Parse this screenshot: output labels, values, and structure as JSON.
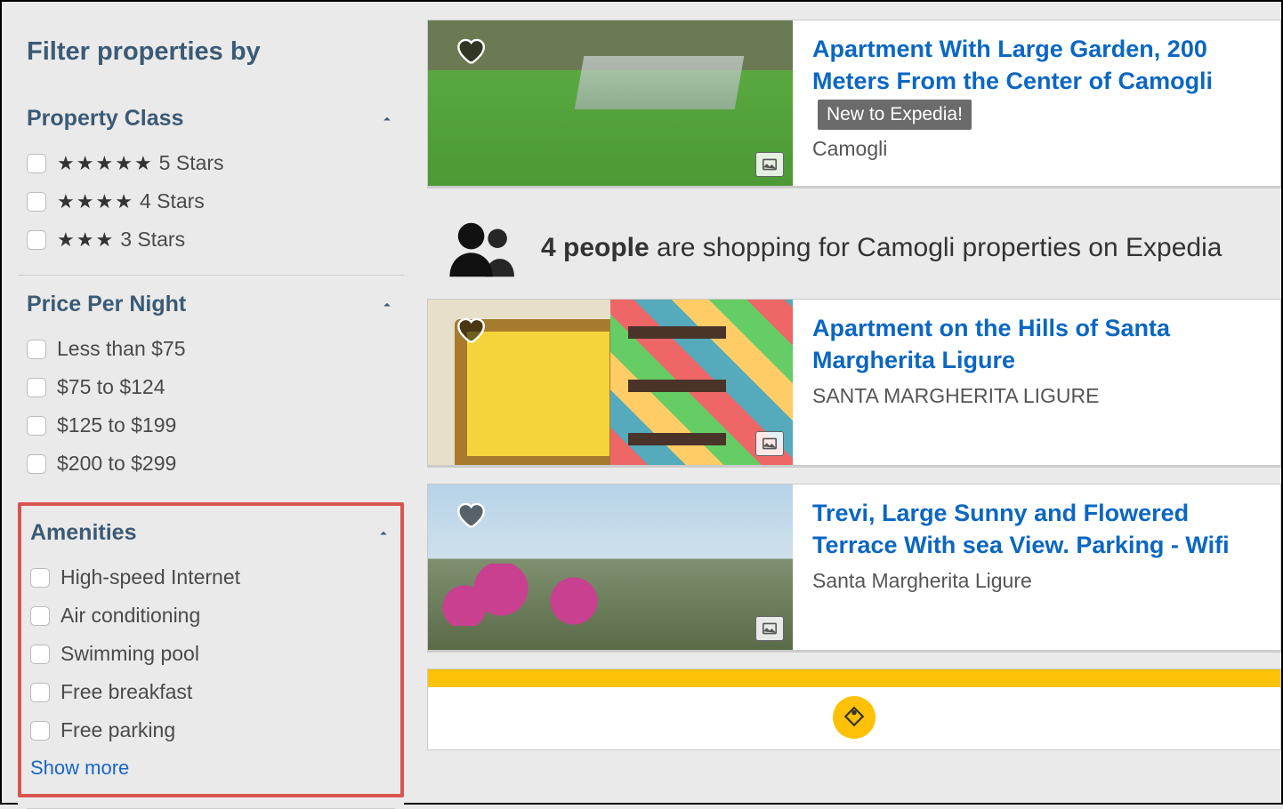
{
  "sidebar": {
    "title": "Filter properties by",
    "sections": {
      "property_class": {
        "title": "Property Class",
        "options": [
          {
            "stars": 5,
            "label": "5 Stars"
          },
          {
            "stars": 4,
            "label": "4 Stars"
          },
          {
            "stars": 3,
            "label": "3 Stars"
          }
        ]
      },
      "price": {
        "title": "Price Per Night",
        "options": [
          {
            "label": "Less than $75"
          },
          {
            "label": "$75 to $124"
          },
          {
            "label": "$125 to $199"
          },
          {
            "label": "$200 to $299"
          }
        ]
      },
      "amenities": {
        "title": "Amenities",
        "options": [
          {
            "label": "High-speed Internet"
          },
          {
            "label": "Air conditioning"
          },
          {
            "label": "Swimming pool"
          },
          {
            "label": "Free breakfast"
          },
          {
            "label": "Free parking"
          }
        ],
        "show_more": "Show more"
      }
    }
  },
  "results": {
    "properties": [
      {
        "title": "Apartment With Large Garden, 200 Meters From the Center of Camogli",
        "badge": "New to Expedia!",
        "location": "Camogli"
      },
      {
        "title": "Apartment on the Hills of Santa Margherita Ligure",
        "location": "SANTA MARGHERITA LIGURE"
      },
      {
        "title": "Trevi, Large Sunny and Flowered Terrace With sea View. Parking - Wifi",
        "location": "Santa Margherita Ligure"
      }
    ],
    "banner": {
      "count": "4 people",
      "rest": " are shopping for Camogli properties on Expedia"
    }
  }
}
